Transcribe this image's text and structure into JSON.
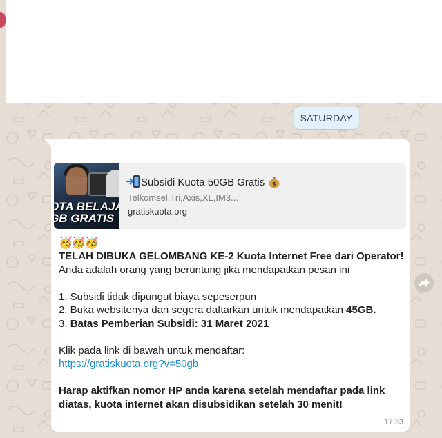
{
  "colors": {
    "wallpaper": "#e6ddd4",
    "bubble": "#ffffff",
    "day_pill": "#e1f2fb",
    "link": "#1f8fd0",
    "timestamp": "#8b8b8b"
  },
  "day_separator": "SATURDAY",
  "message": {
    "preview": {
      "title": "Subsidi Kuota 50GB Gratis",
      "title_prefix_icon": "mobile-phone-arrow-icon",
      "title_suffix_icon": "money-bag-icon",
      "description": "Telkomsel,Tri,Axis,XL,IM3...",
      "domain": "gratiskuota.org",
      "thumbnail_text_line1": "OTA BELAJAR",
      "thumbnail_text_line2": "GB GRATIS"
    },
    "emoji_row": "🥳🥳🥳",
    "headline": "TELAH DIBUKA GELOMBANG KE-2 Kuota Internet Free dari Operator!",
    "intro": "Anda adalah orang yang beruntung jika mendapatkan pesan ini",
    "point1": "1. Subsidi tidak dipungut biaya sepeserpun",
    "point2_prefix": "2. Buka websitenya dan segera daftarkan untuk mendapatkan ",
    "point2_bold": "45GB.",
    "point3_prefix": "3. ",
    "point3_bold": "Batas Pemberian Subsidi: 31 Maret 2021",
    "cta_text": "Klik pada link di bawah untuk mendaftar:",
    "link": "https://gratiskuota.org?v=50gb",
    "footer": "Harap aktifkan nomor HP anda karena setelah mendaftar pada link diatas, kuota internet akan disubsidikan setelah 30 menit!",
    "time": "17:33"
  },
  "forward_button_icon": "forward-arrow-icon"
}
